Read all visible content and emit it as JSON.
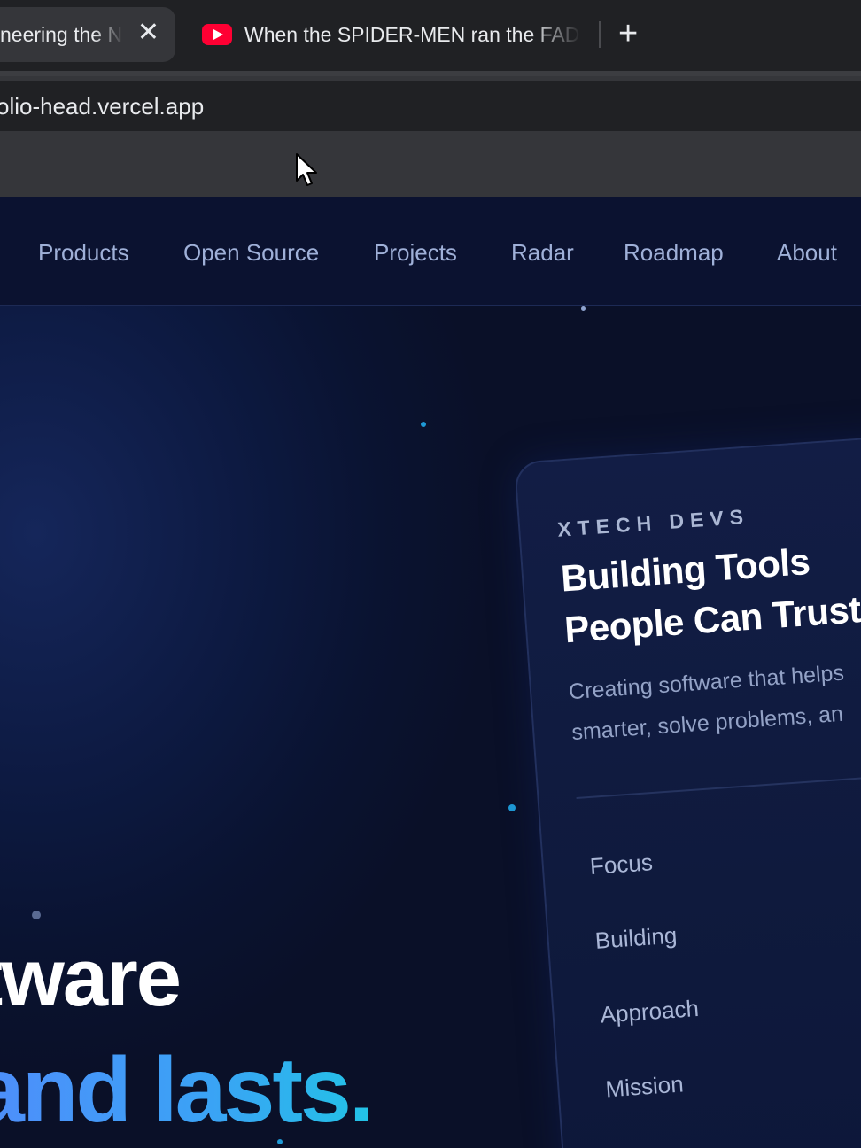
{
  "browser": {
    "tabs": [
      {
        "title": "neering the N",
        "active": true
      },
      {
        "title": "When the SPIDER-MEN ran the FADE",
        "active": false,
        "icon": "youtube-icon"
      }
    ],
    "close_glyph": "✕",
    "new_tab_glyph": "+",
    "address": "olio-head.vercel.app"
  },
  "nav": {
    "items": [
      "Products",
      "Open Source",
      "Projects",
      "Radar",
      "Roadmap",
      "About"
    ]
  },
  "hero": {
    "line1": "ftware",
    "line2": "and lasts."
  },
  "card": {
    "kicker": "XTECH DEVS",
    "title_line1": "Building Tools",
    "title_line2": "People Can Trust",
    "desc_line1": "Creating software that helps",
    "desc_line2": "smarter, solve problems, an",
    "rows": [
      "Focus",
      "Building",
      "Approach",
      "Mission"
    ]
  },
  "colors": {
    "bg": "#0a1028",
    "accent_start": "#4f8dfb",
    "accent_end": "#22c3e6",
    "dot": "#1e9ad6"
  }
}
